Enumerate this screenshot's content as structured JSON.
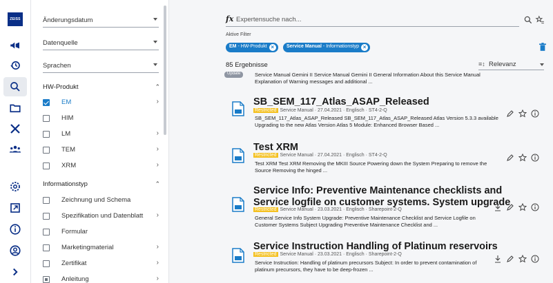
{
  "rail": {
    "logo": "ZEISS",
    "icons": [
      "megaphone-icon",
      "history-icon",
      "search-icon",
      "folder-icon",
      "tools-icon",
      "group-icon",
      "settings-icon",
      "external-link-icon",
      "info-icon",
      "account-icon",
      "expand-icon"
    ]
  },
  "filters": {
    "dropdowns": [
      "Änderungsdatum",
      "Datenquelle",
      "Sprachen"
    ],
    "hw_title": "HW-Produkt",
    "hw_items": [
      {
        "label": "EM",
        "checked": true,
        "arrow": true
      },
      {
        "label": "HIM",
        "checked": false,
        "arrow": false
      },
      {
        "label": "LM",
        "checked": false,
        "arrow": true
      },
      {
        "label": "TEM",
        "checked": false,
        "arrow": true
      },
      {
        "label": "XRM",
        "checked": false,
        "arrow": true
      }
    ],
    "info_title": "Informationstyp",
    "info_items": [
      {
        "label": "Zeichnung und Schema",
        "arrow": false
      },
      {
        "label": "Spezifikation und Datenblatt",
        "arrow": true
      },
      {
        "label": "Formular",
        "arrow": false
      },
      {
        "label": "Marketingmaterial",
        "arrow": true
      },
      {
        "label": "Zertifikat",
        "arrow": true
      },
      {
        "label": "Anleitung",
        "arrow": true
      }
    ]
  },
  "search": {
    "placeholder": "Expertensuche nach...",
    "fx": "fx"
  },
  "active_filters": {
    "label": "Aktive Filter",
    "chips": [
      {
        "bold": "EM",
        "rest": " - HW-Produkt"
      },
      {
        "bold": "Service Manual",
        "rest": " - Informationstyp"
      }
    ]
  },
  "results": {
    "count": "85",
    "count_label": "Ergebnisse",
    "sort_label": "Relevanz",
    "top_badge": "Update",
    "top_snippet_1": "Service Manual Gemini II Service Manual Gemini II General Information About this Service Manual",
    "top_snippet_2": "Explanation of Warning messages and additional ...",
    "items": [
      {
        "title_1": "SB_SEM_117_Atlas_ASAP_Released",
        "title_2": "",
        "restricted": "Restricted",
        "meta": "Service Manual · 27.04.2021 · Englisch · ST4-2-Q",
        "snippet_1": "SB_SEM_117_Atlas_ASAP_Released SB_SEM_117_Atlas_ASAP_Released Atlas Version 5.3.3 available",
        "snippet_2": "Upgrading to the new Atlas Version Atlas 5 Module: Enhanced Browser Based ..."
      },
      {
        "title_1": "Test XRM",
        "title_2": "",
        "restricted": "Restricted",
        "meta": "Service Manual · 27.04.2021 · Englisch · ST4-2-Q",
        "snippet_1": "Test XRM Test XRM Removing the MKIII Source Powering down the System Preparing to remove the",
        "snippet_2": "Source Removing the hinged ..."
      },
      {
        "title_1": "Service Info: Preventive Maintenance checklists and",
        "title_2": "Service logfile on customer systems. System upgrade",
        "restricted": "Restricted",
        "meta": "Service Manual · 23.03.2021 · Englisch · Sharepoint-2-Q",
        "snippet_1": "General Service Info System Upgrade: Preventive Maintenance Checklist and Service Logfile on",
        "snippet_2": "Customer Systems Subject Upgrading Preventive Maintenance Checklist and ..."
      },
      {
        "title_1": "Service Instruction Handling of Platinum reservoirs",
        "title_2": "",
        "restricted": "Restricted",
        "meta": "Service Manual · 23.03.2021 · Englisch · Sharepoint-2-Q",
        "snippet_1": "Service Instruction: Handling of platinum precursors Subject: In order to prevent contamination of",
        "snippet_2": "platinum precursors, they have to be deep-frozen ..."
      }
    ]
  },
  "colors": {
    "accent": "#1a7cc8",
    "restricted": "#f4c01f",
    "brand": "#0a2f87"
  }
}
